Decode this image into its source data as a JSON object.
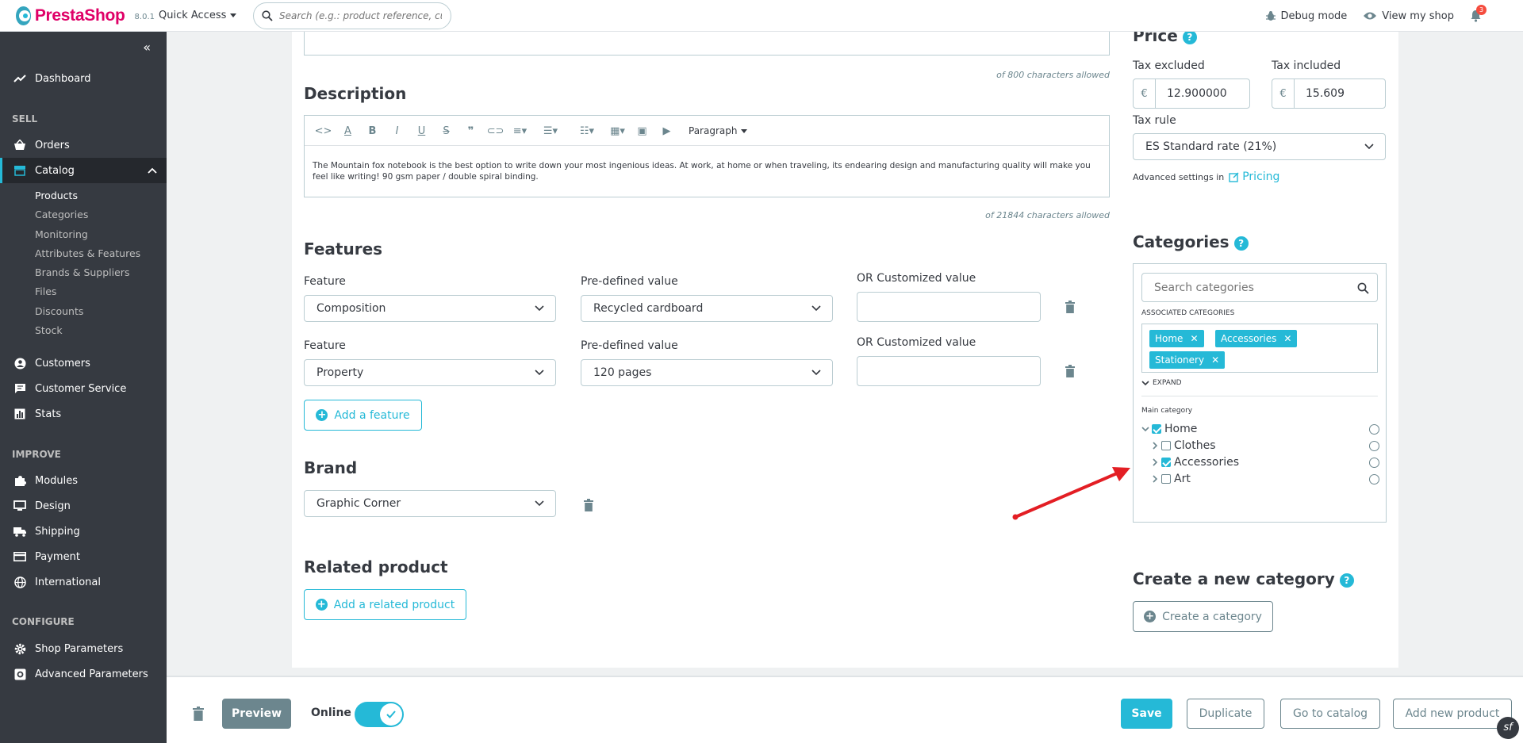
{
  "topbar": {
    "logo_text": "PrestaShop",
    "version": "8.0.1",
    "quick_access": "Quick Access",
    "search_placeholder": "Search (e.g.: product reference, custon",
    "debug_mode": "Debug mode",
    "view_shop": "View my shop",
    "notifications_count": "3"
  },
  "sidebar": {
    "dashboard": "Dashboard",
    "section_sell": "SELL",
    "orders": "Orders",
    "catalog": "Catalog",
    "catalog_sub": [
      "Products",
      "Categories",
      "Monitoring",
      "Attributes & Features",
      "Brands & Suppliers",
      "Files",
      "Discounts",
      "Stock"
    ],
    "customers": "Customers",
    "customer_service": "Customer Service",
    "stats": "Stats",
    "section_improve": "IMPROVE",
    "modules": "Modules",
    "design": "Design",
    "shipping": "Shipping",
    "payment": "Payment",
    "international": "International",
    "section_configure": "CONFIGURE",
    "shop_parameters": "Shop Parameters",
    "advanced_parameters": "Advanced Parameters"
  },
  "main": {
    "summary_hint": "of 800 characters allowed",
    "description_title": "Description",
    "editor_format": "Paragraph",
    "description_text": "The Mountain fox notebook is the best option to write down your most ingenious ideas. At work, at home or when traveling, its endearing design and manufacturing quality will make you feel like writing! 90 gsm paper / double spiral binding.",
    "description_hint": "of 21844 characters allowed",
    "features_title": "Features",
    "features": [
      {
        "feature_label": "Feature",
        "feature_value": "Composition",
        "predefined_label": "Pre-defined value",
        "predefined_value": "Recycled cardboard",
        "custom_label": "OR Customized value",
        "custom_value": ""
      },
      {
        "feature_label": "Feature",
        "feature_value": "Property",
        "predefined_label": "Pre-defined value",
        "predefined_value": "120 pages",
        "custom_label": "OR Customized value",
        "custom_value": ""
      }
    ],
    "add_feature": "Add a feature",
    "brand_title": "Brand",
    "brand_value": "Graphic Corner",
    "related_title": "Related product",
    "add_related": "Add a related product"
  },
  "right": {
    "price_title": "Price",
    "tax_excluded_label": "Tax excluded",
    "tax_excluded_value": "12.900000",
    "tax_included_label": "Tax included",
    "tax_included_value": "15.609",
    "currency": "€",
    "tax_rule_label": "Tax rule",
    "tax_rule_value": "ES Standard rate (21%)",
    "advanced_prefix": "Advanced settings in",
    "pricing_link": "Pricing",
    "categories_title": "Categories",
    "search_categories_placeholder": "Search categories",
    "associated_label": "ASSOCIATED CATEGORIES",
    "associated": [
      "Home",
      "Accessories",
      "Stationery"
    ],
    "expand": "EXPAND",
    "main_category_label": "Main category",
    "tree": [
      {
        "name": "Home",
        "checked": true
      },
      {
        "name": "Clothes",
        "checked": false
      },
      {
        "name": "Accessories",
        "checked": true
      },
      {
        "name": "Art",
        "checked": false
      }
    ],
    "create_title": "Create a new category",
    "create_button": "Create a category"
  },
  "footer": {
    "preview": "Preview",
    "online": "Online",
    "save": "Save",
    "duplicate": "Duplicate",
    "go_to_catalog": "Go to catalog",
    "add_new_product": "Add new product"
  },
  "colors": {
    "accent": "#25b9d7",
    "sidebar": "#363a41",
    "brand_pink": "#df0067",
    "annotation_arrow": "#e31e24"
  }
}
